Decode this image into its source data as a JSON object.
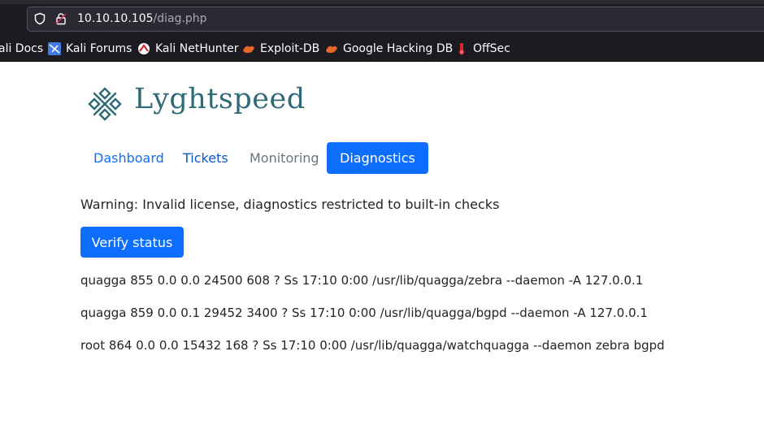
{
  "browser": {
    "url_host": "10.10.10.105",
    "url_path": "/diag.php",
    "bookmarks": [
      {
        "label": "ali Docs",
        "icon": "kali-docs-icon"
      },
      {
        "label": "Kali Forums",
        "icon": "kali-forums-icon"
      },
      {
        "label": "Kali NetHunter",
        "icon": "kali-nethunter-icon"
      },
      {
        "label": "Exploit-DB",
        "icon": "exploit-db-icon"
      },
      {
        "label": "Google Hacking DB",
        "icon": "ghdb-icon"
      },
      {
        "label": "OffSec",
        "icon": "offsec-icon"
      }
    ]
  },
  "brand": {
    "name": "Lyghtspeed",
    "color": "#2e6a77"
  },
  "nav": {
    "dashboard": "Dashboard",
    "tickets": "Tickets",
    "monitoring": "Monitoring",
    "diagnostics": "Diagnostics"
  },
  "main": {
    "warning": "Warning: Invalid license, diagnostics restricted to built-in checks",
    "verify_label": "Verify status",
    "processes": [
      "quagga 855 0.0 0.0 24500 608 ? Ss 17:10 0:00 /usr/lib/quagga/zebra --daemon -A 127.0.0.1",
      "quagga 859 0.0 0.1 29452 3400 ? Ss 17:10 0:00 /usr/lib/quagga/bgpd --daemon -A 127.0.0.1",
      "root 864 0.0 0.0 15432 168 ? Ss 17:10 0:00 /usr/lib/quagga/watchquagga --daemon zebra bgpd"
    ]
  },
  "colors": {
    "primary": "#0d6efd",
    "chrome": "#1c1b22"
  }
}
